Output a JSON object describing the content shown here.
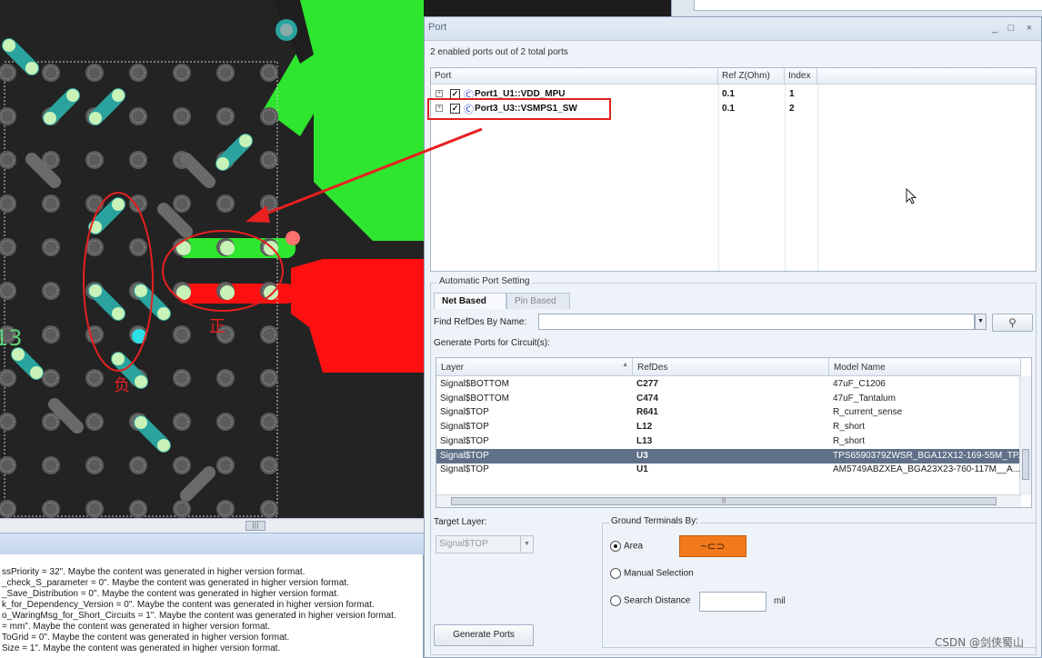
{
  "port_window": {
    "title": "Port",
    "window_controls": {
      "minimize": "_",
      "maximize": "□",
      "close": "×"
    },
    "summary": "2 enabled ports out of 2 total ports",
    "port_table": {
      "columns": [
        "Port",
        "Ref Z(Ohm)",
        "Index"
      ],
      "rows": [
        {
          "expander": "+",
          "checked": "✓",
          "icon": "circle-c-icon",
          "icon_glyph": "Ⓒ",
          "name": "Port1_U1::VDD_MPU",
          "ref_z": "0.1",
          "index": "1"
        },
        {
          "expander": "+",
          "checked": "✓",
          "icon": "circle-c-icon",
          "icon_glyph": "Ⓒ",
          "name": "Port3_U3::VSMPS1_SW",
          "ref_z": "0.1",
          "index": "2"
        }
      ]
    },
    "auto_port_setting": {
      "group_label": "Automatic Port Setting",
      "tabs": [
        "Net Based",
        "Pin Based"
      ],
      "find_label": "Find RefDes By Name:",
      "find_value": "",
      "find_button_glyph": "⚲",
      "generate_label": "Generate Ports for Circuit(s):",
      "circuit_table": {
        "columns": [
          "Layer",
          "RefDes",
          "Model Name"
        ],
        "rows": [
          {
            "layer": "Signal$BOTTOM",
            "refdes": "C277",
            "model": "47uF_C1206"
          },
          {
            "layer": "Signal$BOTTOM",
            "refdes": "C474",
            "model": "47uF_Tantalum"
          },
          {
            "layer": "Signal$TOP",
            "refdes": "R641",
            "model": "R_current_sense"
          },
          {
            "layer": "Signal$TOP",
            "refdes": "L12",
            "model": "R_short"
          },
          {
            "layer": "Signal$TOP",
            "refdes": "L13",
            "model": "R_short"
          },
          {
            "layer": "Signal$TOP",
            "refdes": "U3",
            "model": "TPS6590379ZWSR_BGA12X12-169-55M_TP..."
          },
          {
            "layer": "Signal$TOP",
            "refdes": "U1",
            "model": "AM5749ABZXEA_BGA23X23-760-117M__A..."
          }
        ],
        "selected_row": "U3"
      },
      "target_layer_label": "Target Layer:",
      "target_layer_value": "Signal$TOP",
      "ground_label": "Ground Terminals By:",
      "ground_options": [
        "Area",
        "Manual Selection",
        "Search Distance"
      ],
      "ground_selected": "Area",
      "area_button_glyph": "~⊂⊃",
      "distance_unit": "mil",
      "generate_button": "Generate Ports"
    }
  },
  "pcb": {
    "annotations": {
      "negative": "负",
      "positive": "正"
    },
    "designator_fragment": "13",
    "scroll_thumb_glyph": "|||"
  },
  "log": {
    "lines": [
      "ssPriority = 32\". Maybe the content was generated in higher version format.",
      "_check_S_parameter = 0\". Maybe the content was generated in higher version format.",
      "_Save_Distribution = 0\". Maybe the content was generated in higher version format.",
      "k_for_Dependency_Version = 0\". Maybe the content was generated in higher version format.",
      "o_WaringMsg_for_Short_Circuits = 1\". Maybe the content was generated in higher version format.",
      " = mm\". Maybe the content was generated in higher version format.",
      "ToGrid = 0\". Maybe the content was generated in higher version format.",
      "Size = 1\". Maybe the content was generated in higher version format."
    ]
  },
  "watermark": "CSDN @剑侠蜀山",
  "colors": {
    "highlight_red": "#e32020",
    "positive_net": "#2fe62f",
    "negative_net": "#ff1010",
    "pad_teal": "#2aa39e",
    "pad_light": "#c8f2b8",
    "selected_row": "#5f7088",
    "area_button": "#f27a1c"
  }
}
